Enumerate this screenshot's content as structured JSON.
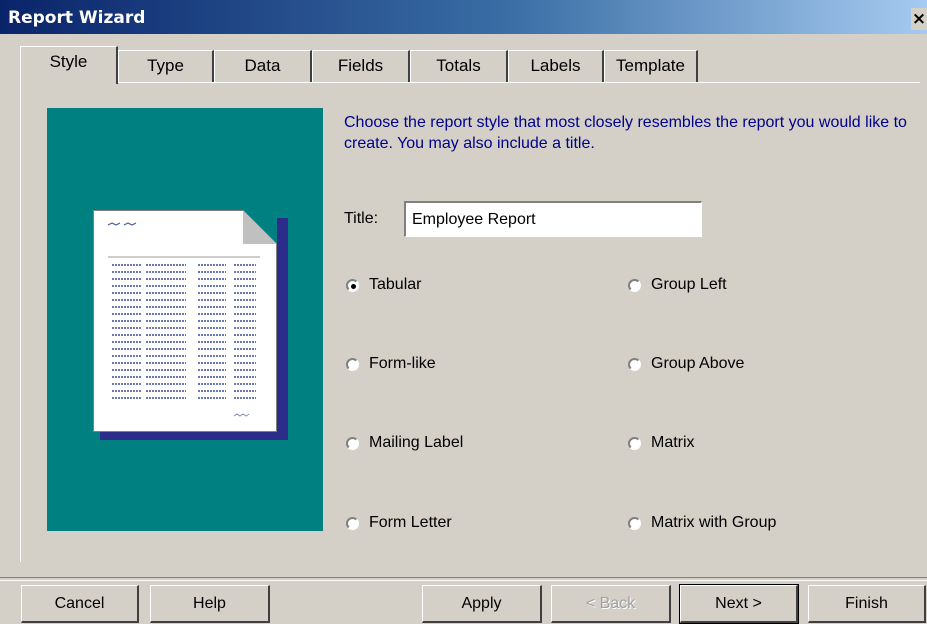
{
  "window": {
    "title": "Report Wizard",
    "close_label": "×"
  },
  "tabs": [
    {
      "label": "Style"
    },
    {
      "label": "Type"
    },
    {
      "label": "Data"
    },
    {
      "label": "Fields"
    },
    {
      "label": "Totals"
    },
    {
      "label": "Labels"
    },
    {
      "label": "Template"
    }
  ],
  "instructions": "Choose the report style that most closely resembles the report you would like to create. You may also include a title.",
  "title_field": {
    "label": "Title:",
    "value": "Employee Report"
  },
  "styles": {
    "tabular": "Tabular",
    "group_left": "Group Left",
    "form_like": "Form-like",
    "group_above": "Group Above",
    "mailing_label": "Mailing Label",
    "matrix": "Matrix",
    "form_letter": "Form Letter",
    "matrix_with_group": "Matrix with Group",
    "selected": "tabular"
  },
  "buttons": {
    "cancel": "Cancel",
    "help": "Help",
    "apply": "Apply",
    "back": "< Back",
    "next": "Next >",
    "finish": "Finish"
  }
}
